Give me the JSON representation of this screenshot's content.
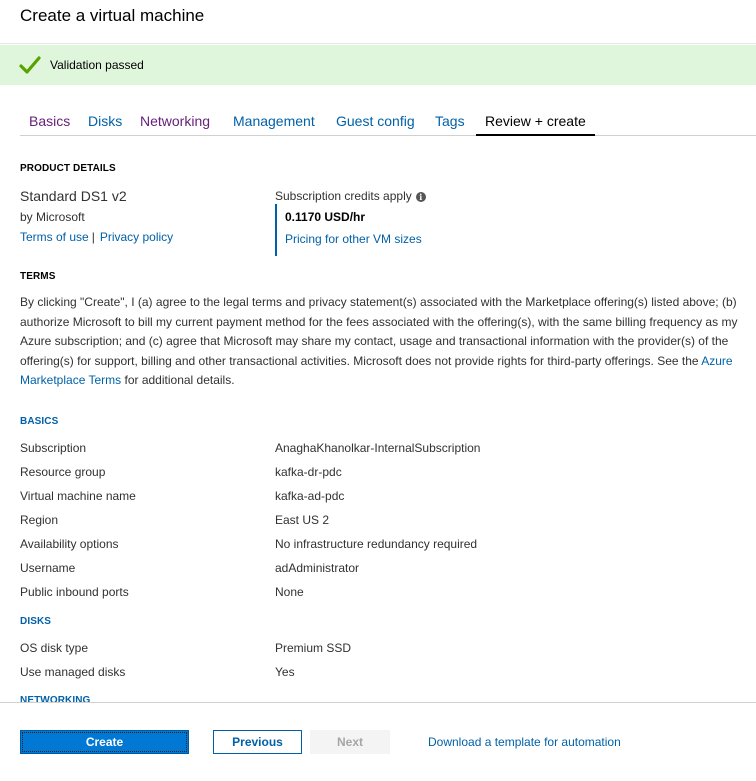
{
  "window": {
    "title": "Create a virtual machine"
  },
  "validation": {
    "message": "Validation passed",
    "color": "#dff6dd",
    "icon": "checkmark-icon"
  },
  "tabs": [
    {
      "label": "Basics",
      "state": "visited"
    },
    {
      "label": "Disks",
      "state": "link"
    },
    {
      "label": "Networking",
      "state": "visited"
    },
    {
      "label": "Management",
      "state": "link"
    },
    {
      "label": "Guest config",
      "state": "link"
    },
    {
      "label": "Tags",
      "state": "link"
    },
    {
      "label": "Review + create",
      "state": "active"
    }
  ],
  "product": {
    "section_title": "PRODUCT DETAILS",
    "name": "Standard DS1 v2",
    "publisher": "by Microsoft",
    "terms_link": "Terms of use",
    "separator": "|",
    "privacy_link": "Privacy policy",
    "credits_label": "Subscription credits apply",
    "price": "0.1170 USD/hr",
    "pricing_link": "Pricing for other VM sizes"
  },
  "terms": {
    "section_title": "TERMS",
    "text_before_link": "By clicking \"Create\", I (a) agree to the legal terms and privacy statement(s) associated with the Marketplace offering(s) listed above; (b) authorize Microsoft to bill my current payment method for the fees associated with the offering(s), with the same billing frequency as my Azure subscription; and (c) agree that Microsoft may share my contact, usage and transactional information with the provider(s) of the offering(s) for support, billing and other transactional activities. Microsoft does not provide rights for third-party offerings. See the ",
    "link": "Azure Marketplace Terms",
    "text_after_link": " for additional details."
  },
  "basics": {
    "section_title": "BASICS",
    "rows": [
      {
        "label": "Subscription",
        "value": "AnaghaKhanolkar-InternalSubscription"
      },
      {
        "label": "Resource group",
        "value": "kafka-dr-pdc"
      },
      {
        "label": "Virtual machine name",
        "value": "kafka-ad-pdc"
      },
      {
        "label": "Region",
        "value": "East US 2"
      },
      {
        "label": "Availability options",
        "value": "No infrastructure redundancy required"
      },
      {
        "label": "Username",
        "value": "adAdministrator"
      },
      {
        "label": "Public inbound ports",
        "value": "None"
      }
    ]
  },
  "disks": {
    "section_title": "DISKS",
    "rows": [
      {
        "label": "OS disk type",
        "value": "Premium SSD"
      },
      {
        "label": "Use managed disks",
        "value": "Yes"
      }
    ]
  },
  "networking": {
    "section_title": "NETWORKING"
  },
  "footer": {
    "create_label": "Create",
    "previous_label": "Previous",
    "next_label": "Next",
    "download_link": "Download a template for automation"
  },
  "colors": {
    "accent": "#0078d4",
    "link": "#0061a8",
    "visited": "#68217a",
    "success": "#57a300"
  }
}
